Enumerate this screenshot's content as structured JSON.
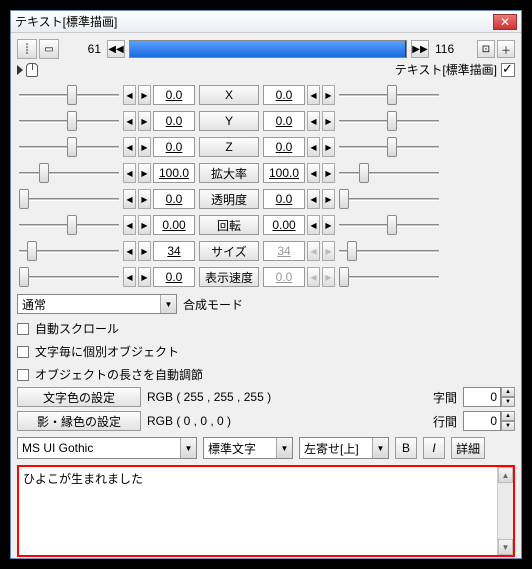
{
  "window": {
    "title": "テキスト[標準描画]"
  },
  "timeline": {
    "start": "61",
    "end": "116"
  },
  "header2": {
    "label": "テキスト[標準描画]",
    "checked": true
  },
  "params": [
    {
      "name": "X",
      "left": "0.0",
      "right": "0.0",
      "thumbL": 48,
      "thumbR": 48
    },
    {
      "name": "Y",
      "left": "0.0",
      "right": "0.0",
      "thumbL": 48,
      "thumbR": 48
    },
    {
      "name": "Z",
      "left": "0.0",
      "right": "0.0",
      "thumbL": 48,
      "thumbR": 48
    },
    {
      "name": "拡大率",
      "left": "100.0",
      "right": "100.0",
      "thumbL": 20,
      "thumbR": 20
    },
    {
      "name": "透明度",
      "left": "0.0",
      "right": "0.0",
      "thumbL": 0,
      "thumbR": 0
    },
    {
      "name": "回転",
      "left": "0.00",
      "right": "0.00",
      "thumbL": 48,
      "thumbR": 48
    },
    {
      "name": "サイズ",
      "left": "34",
      "right": "34",
      "thumbL": 8,
      "thumbR": 8,
      "dis": true
    },
    {
      "name": "表示速度",
      "left": "0.0",
      "right": "0.0",
      "thumbL": 0,
      "thumbR": 0,
      "dis": true
    }
  ],
  "blend": {
    "label": "合成モード",
    "value": "通常"
  },
  "checks": {
    "autoscroll": "自動スクロール",
    "perchar": "文字毎に個別オブジェクト",
    "autolen": "オブジェクトの長さを自動調節"
  },
  "colors": {
    "text_btn": "文字色の設定",
    "text_rgb": "RGB ( 255 , 255 , 255 )",
    "shadow_btn": "影・縁色の設定",
    "shadow_rgb": "RGB ( 0 , 0 , 0 )",
    "spacing_lbl": "字間",
    "spacing_val": "0",
    "leading_lbl": "行間",
    "leading_val": "0"
  },
  "font": {
    "family": "MS UI Gothic",
    "weight": "標準文字",
    "align": "左寄せ[上]",
    "bold": "B",
    "italic": "I",
    "detail": "詳細"
  },
  "textarea": {
    "value": "ひよこが生まれました"
  }
}
